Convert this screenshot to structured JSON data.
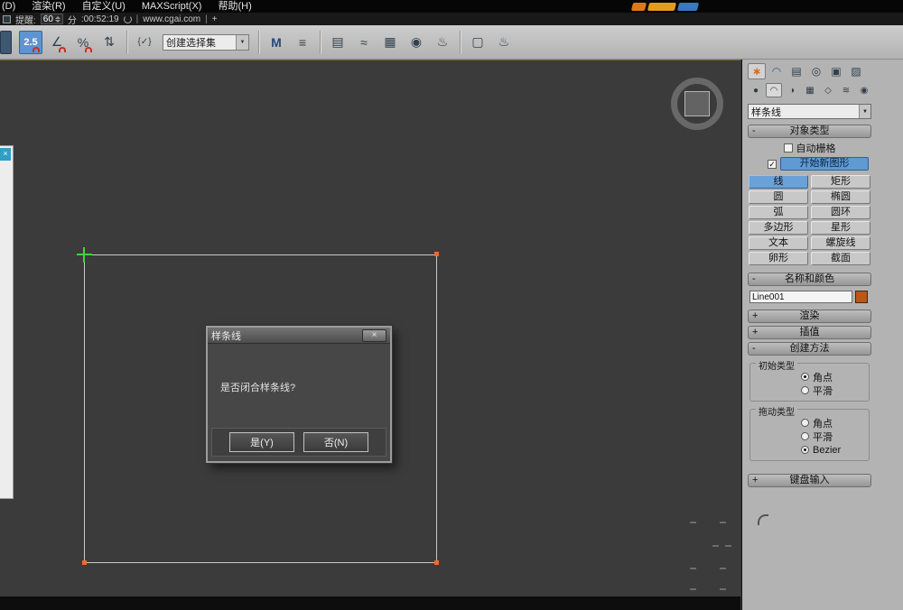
{
  "glyphs": {
    "expanded": "-",
    "collapsed": "+",
    "arrow_down": "▼",
    "check": "✓",
    "close": "×",
    "plus": "+",
    "pipe": "|"
  },
  "menubar": {
    "items": [
      "(D)",
      "渲染(R)",
      "自定义(U)",
      "MAXScript(X)",
      "帮助(H)"
    ]
  },
  "infobar": {
    "label": "提醒:",
    "value": "60",
    "unit": "分",
    "time": ":00:52:19",
    "site": "www.cgai.com"
  },
  "toolbar": {
    "selection_set_value": "创建选择集"
  },
  "icons": {
    "snap_toggle": "2.5",
    "angle_snap": "∠",
    "percent_snap": "%",
    "spinner_snap": "⇅",
    "named_selection": "{✓}",
    "mirror": "M",
    "align": "≡",
    "layer_manager": "▤",
    "curve_editor": "≈",
    "schematic_view": "▦",
    "material_editor": "◉",
    "render_setup": "♨",
    "rendered_frame": "▢",
    "quick_render": "♨",
    "tab_create": "∗",
    "tab_modify": "◠",
    "tab_hierarchy": "▤",
    "tab_motion": "◎",
    "tab_display": "▣",
    "tab_utilities": "▨",
    "cat_geometry": "●",
    "cat_shapes": "◠",
    "cat_lights": "◑",
    "cat_cameras": "▦",
    "cat_helpers": "◇",
    "cat_spacewarps": "≋",
    "cat_systems": "◉"
  },
  "viewport": {
    "dialog": {
      "title": "样条线",
      "message": "是否闭合样条线?",
      "yes_label": "是(Y)",
      "no_label": "否(N)"
    }
  },
  "panel": {
    "shape_type_value": "样条线",
    "object_type": {
      "title": "对象类型",
      "autogrid_label": "自动栅格",
      "start_new_shape_label": "开始新图形",
      "buttons": [
        "线",
        "矩形",
        "圆",
        "椭圆",
        "弧",
        "圆环",
        "多边形",
        "星形",
        "文本",
        "螺旋线",
        "卵形",
        "截面"
      ],
      "active_button": "线"
    },
    "name_color": {
      "title": "名称和颜色",
      "name_value": "Line001",
      "object_color": "#bb5717"
    },
    "rendering_title": "渲染",
    "interpolation_title": "插值",
    "creation_method": {
      "title": "创建方法",
      "initial_type": {
        "title": "初始类型",
        "options": [
          "角点",
          "平滑"
        ],
        "selected": "角点"
      },
      "drag_type": {
        "title": "拖动类型",
        "options": [
          "角点",
          "平滑",
          "Bezier"
        ],
        "selected": "Bezier"
      }
    },
    "keyboard_entry_title": "键盘输入"
  }
}
